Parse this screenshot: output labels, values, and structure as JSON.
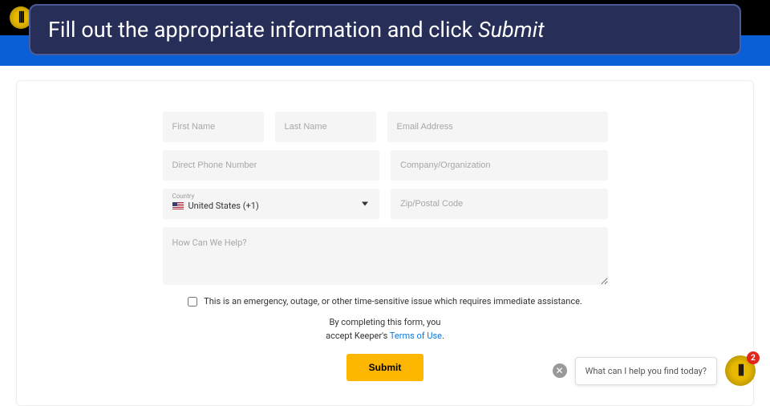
{
  "instruction": {
    "prefix": "Fill out the appropriate information and click ",
    "action": "Submit"
  },
  "form": {
    "first_name_placeholder": "First Name",
    "last_name_placeholder": "Last Name",
    "email_placeholder": "Email Address",
    "phone_placeholder": "Direct Phone Number",
    "company_placeholder": "Company/Organization",
    "country_label": "Country",
    "country_value": "United States (+1)",
    "zip_placeholder": "Zip/Postal Code",
    "help_placeholder": "How Can We Help?",
    "emergency_label": "This is an emergency, outage, or other time-sensitive issue which requires immediate assistance.",
    "consent_line1": "By completing this form, you",
    "consent_line2_prefix": "accept Keeper's ",
    "consent_link": "Terms of Use",
    "consent_line2_suffix": ".",
    "submit_label": "Submit"
  },
  "chat": {
    "prompt": "What can I help you find today?",
    "badge_count": "2"
  }
}
